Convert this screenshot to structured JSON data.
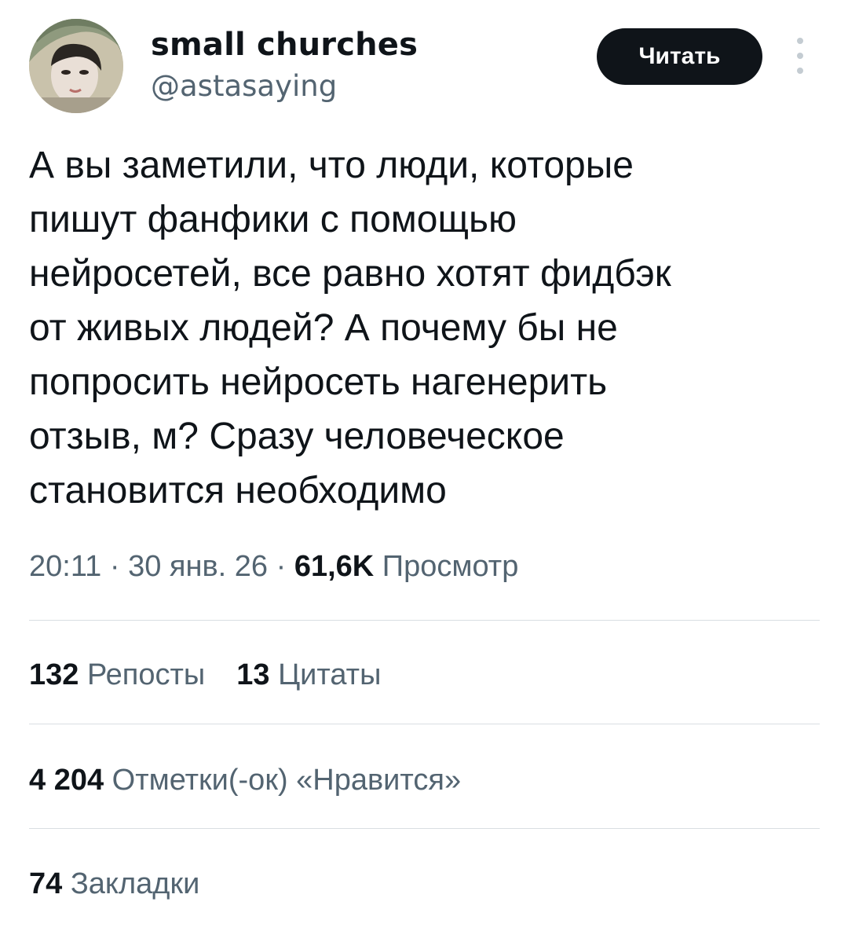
{
  "author": {
    "name": "small churches",
    "handle": "@astasaying"
  },
  "follow_button": {
    "label": "Читать"
  },
  "tweet": {
    "lines": [
      "А вы заметили, что люди, которые",
      "пишут фанфики с помощью",
      "нейросетей, все равно хотят фидбэк",
      "от живых людей? А почему бы не",
      "попросить нейросеть нагенерить",
      "отзыв, м? Сразу человеческое",
      "становится необходимо"
    ]
  },
  "meta": {
    "time": "20:11",
    "sep1": " · ",
    "date": "30 янв. 26",
    "sep2": " · ",
    "views_count": "61,6K",
    "views_label": "Просмотр"
  },
  "stats": {
    "reposts": {
      "count": "132",
      "label": "Репосты"
    },
    "quotes": {
      "count": "13",
      "label": "Цитаты"
    },
    "likes": {
      "count": "4 204",
      "label": "Отметки(-ок) «Нравится»"
    },
    "bookmarks": {
      "count": "74",
      "label": "Закладки"
    }
  },
  "colors": {
    "text_primary": "#0f1419",
    "text_secondary": "#536471",
    "button_bg": "#0f1419",
    "divider": "#d9dee2"
  },
  "icons": {
    "more": "more-vertical-icon"
  }
}
